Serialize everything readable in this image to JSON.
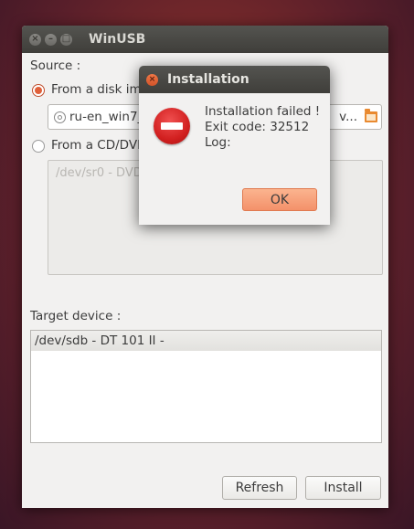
{
  "window": {
    "title": "WinUSB"
  },
  "source": {
    "label": "Source :",
    "disk_image_label": "From a disk image (iso)",
    "disk_image_selected": true,
    "disk_image_path": "ru-en_win7_",
    "disk_image_path_tail": "v...",
    "cd_label": "From a CD/DVD drive",
    "cd_selected": false,
    "cd_device": "/dev/sr0 - DVD"
  },
  "target": {
    "label": "Target device :",
    "devices": [
      "/dev/sdb - DT 101 II -"
    ]
  },
  "buttons": {
    "refresh": "Refresh",
    "install": "Install"
  },
  "dialog": {
    "title": "Installation",
    "line1": "Installation failed !",
    "line2": "Exit code: 32512",
    "line3": "Log:",
    "ok": "OK"
  },
  "colors": {
    "accent": "#e0603a",
    "error": "#d22020"
  }
}
